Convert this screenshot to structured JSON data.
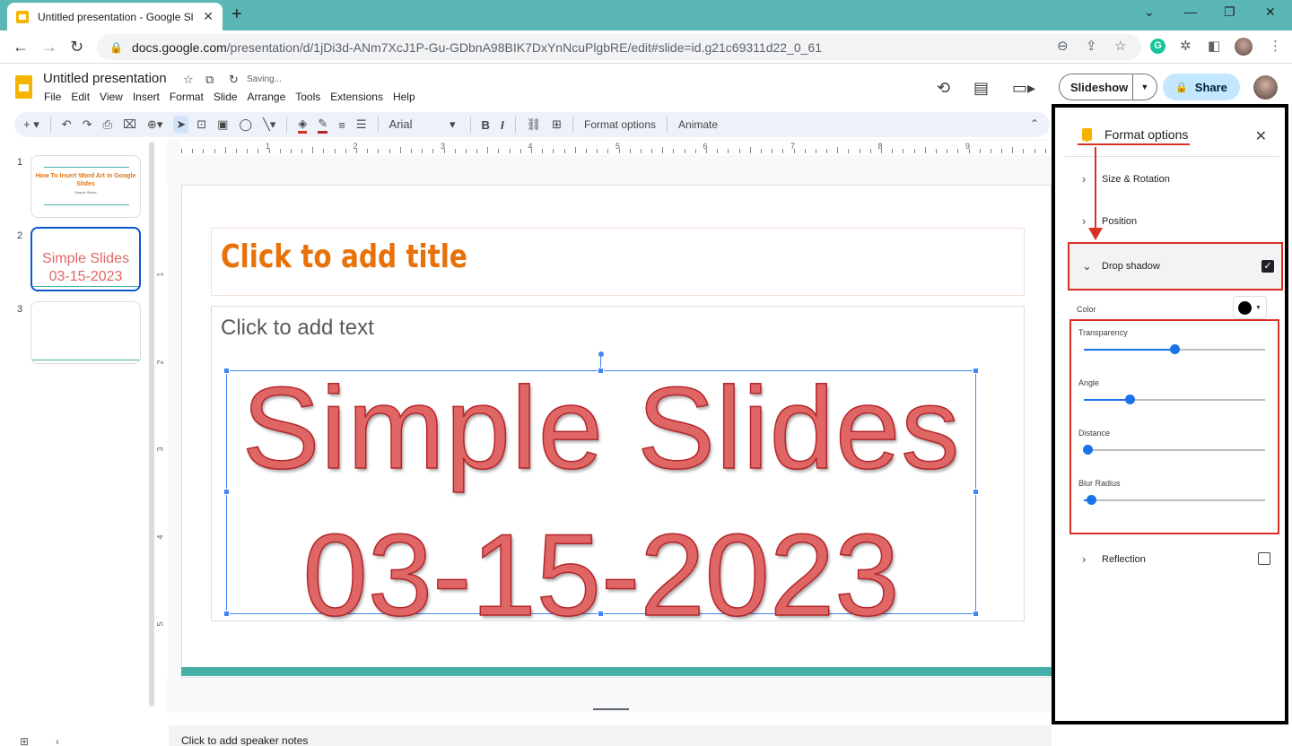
{
  "browser": {
    "tab_title": "Untitled presentation - Google Sl",
    "tab_close": "✕",
    "new_tab": "+",
    "minimize": "⌄",
    "win_min": "—",
    "win_restore": "❐",
    "win_close": "✕",
    "url_host": "docs.google.com",
    "url_path": "/presentation/d/1jDi3d-ANm7XcJ1P-Gu-GDbnA98BIK7DxYnNcuPlgbRE/edit#slide=id.g21c69311d22_0_61",
    "back": "←",
    "forward": "→",
    "reload": "↻",
    "ext_g": "G",
    "icons": [
      "zoom-icon",
      "share-page-icon",
      "bookmark-star-icon",
      "extensions-icon",
      "sidebar-icon",
      "profile-icon",
      "menu-kebab-icon"
    ]
  },
  "app": {
    "doc_title": "Untitled presentation",
    "saving": "Saving...",
    "menus": [
      "File",
      "Edit",
      "View",
      "Insert",
      "Format",
      "Slide",
      "Arrange",
      "Tools",
      "Extensions",
      "Help"
    ],
    "slideshow": "Slideshow",
    "share": "Share"
  },
  "toolbar": {
    "font": "Arial",
    "format_options": "Format options",
    "animate": "Animate",
    "bold": "B",
    "italic": "I"
  },
  "filmstrip": {
    "slides": [
      {
        "num": "1",
        "title": "How To Insert Word Art in Google Slides",
        "sub": "Simple Slides"
      },
      {
        "num": "2",
        "text": "Simple Slides 03-15-2023"
      },
      {
        "num": "3"
      }
    ]
  },
  "ruler": {
    "h_labels": [
      "1",
      "2",
      "3",
      "4",
      "5",
      "6",
      "7",
      "8",
      "9"
    ],
    "v_labels": [
      "1",
      "2",
      "3",
      "4",
      "5"
    ]
  },
  "slide": {
    "title_placeholder": "Click to add title",
    "body_placeholder": "Click to add text",
    "wordart_line1": "Simple Slides",
    "wordart_line2": "03-15-2023",
    "accent_color": "#45b0a8",
    "title_color": "#e8710a",
    "wordart_color": "#e06666"
  },
  "notes": {
    "placeholder": "Click to add speaker notes"
  },
  "format_panel": {
    "title": "Format options",
    "close": "✕",
    "size_rotation": "Size & Rotation",
    "position": "Position",
    "drop_shadow": "Drop shadow",
    "drop_shadow_checked": true,
    "color_label": "Color",
    "shadow_color": "#000000",
    "reflection": "Reflection",
    "reflection_checked": false,
    "sliders": [
      {
        "label": "Transparency",
        "value": 0.5
      },
      {
        "label": "Angle",
        "value": 0.25
      },
      {
        "label": "Distance",
        "value": 0.02
      },
      {
        "label": "Blur Radius",
        "value": 0.04
      }
    ]
  }
}
